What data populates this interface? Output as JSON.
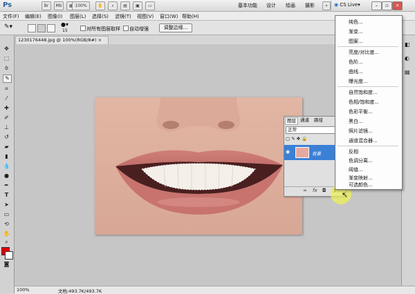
{
  "app": {
    "logo": "Ps",
    "zoom": "100%",
    "workspaces": [
      "基本功能",
      "设计",
      "绘画",
      "摄影"
    ],
    "more": "»",
    "cslive": "CS Live▾"
  },
  "menus": [
    "文件(F)",
    "编辑(E)",
    "图像(I)",
    "图层(L)",
    "选择(S)",
    "滤镜(T)",
    "视图(V)",
    "窗口(W)",
    "帮助(H)"
  ],
  "options": {
    "brush_size": "15",
    "sample_all": "对所有图层取样",
    "auto_enhance": "自动增强",
    "refine_edge": "调整边缘..."
  },
  "document": {
    "tab_title": "1230176448.jpg @ 100%(RGB/8#)",
    "status_zoom": "100%",
    "status_doc": "文档:493.7K/493.7K"
  },
  "layers": {
    "tabs": [
      "图层",
      "通道",
      "路径"
    ],
    "blend_mode": "正常",
    "layer_name": "背景"
  },
  "dropdown": {
    "groups": [
      [
        "纯色...",
        "渐变...",
        "图案..."
      ],
      [
        "亮度/对比度...",
        "色阶...",
        "曲线...",
        "曝光度..."
      ],
      [
        "自然饱和度...",
        "色相/饱和度...",
        "色彩平衡...",
        "黑白...",
        "照片滤镜...",
        "通道混合器..."
      ],
      [
        "反相",
        "色调分离...",
        "阈值...",
        "渐变映射...",
        "可选颜色..."
      ]
    ]
  },
  "colors": {
    "foreground": "#e00000",
    "background": "#ffffff",
    "layer_selected": "#3a80d6"
  }
}
